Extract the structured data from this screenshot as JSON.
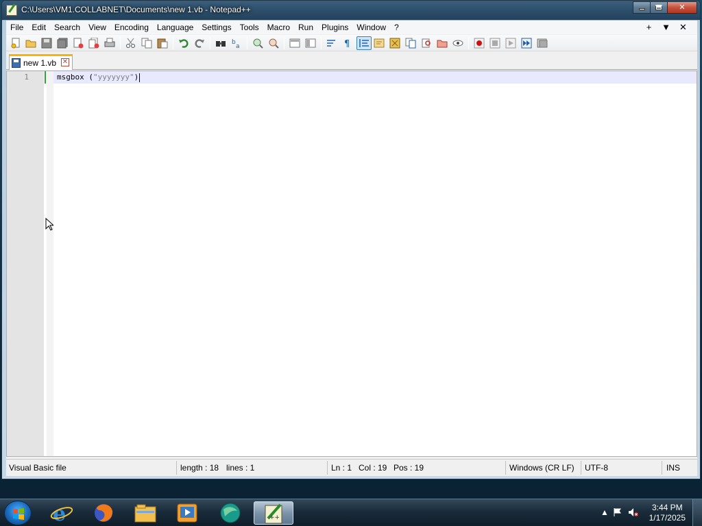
{
  "window": {
    "title": "C:\\Users\\VM1.COLLABNET\\Documents\\new 1.vb - Notepad++",
    "controls": {
      "minimize": "minimize",
      "maximize": "maximize",
      "close": "✕"
    }
  },
  "menubar": {
    "items": [
      "File",
      "Edit",
      "Search",
      "View",
      "Encoding",
      "Language",
      "Settings",
      "Tools",
      "Macro",
      "Run",
      "Plugins",
      "Window",
      "?"
    ],
    "right": [
      "+",
      "▼",
      "✕"
    ]
  },
  "toolbar": {
    "buttons": [
      "new-file",
      "open-file",
      "save",
      "save-all",
      "close",
      "close-all",
      "print",
      "cut",
      "copy",
      "paste",
      "undo",
      "redo",
      "find",
      "replace",
      "zoom-in",
      "zoom-out",
      "sync-vertical",
      "sync-horizontal",
      "word-wrap",
      "show-all-chars",
      "indent-guide",
      "user-defined-language",
      "document-map",
      "function-list",
      "folder-as-workspace",
      "monitoring",
      "record-macro",
      "stop-recording",
      "playback-macro",
      "run-macro-multiple",
      "save-macro"
    ]
  },
  "tabs": [
    {
      "label": "new 1.vb",
      "close": "✕"
    }
  ],
  "editor": {
    "lines": [
      {
        "number": "1",
        "keyword": "msgbox",
        "open": " (",
        "string": "\"yyyyyyy\"",
        "close": ")"
      }
    ]
  },
  "statusbar": {
    "language": "Visual Basic file",
    "length": "length : 18",
    "lines": "lines : 1",
    "ln": "Ln : 1",
    "col": "Col : 19",
    "pos": "Pos : 19",
    "eol": "Windows (CR LF)",
    "encoding": "UTF-8",
    "mode": "INS"
  },
  "taskbar": {
    "apps": [
      "start",
      "internet-explorer",
      "firefox",
      "file-explorer",
      "media-player",
      "edge-globe",
      "notepad-plus-plus"
    ],
    "clock_time": "3:44 PM",
    "clock_date": "1/17/2025"
  }
}
